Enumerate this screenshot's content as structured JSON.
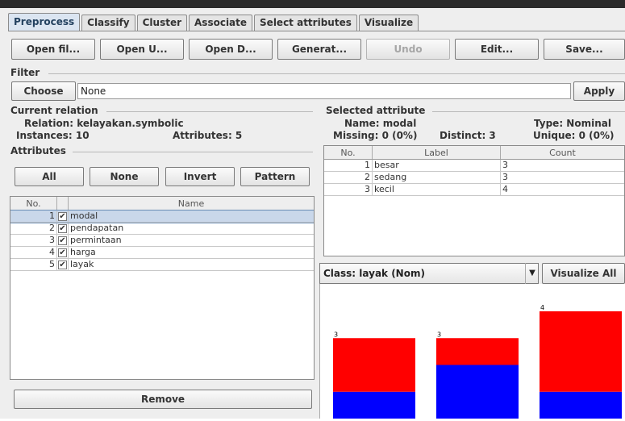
{
  "tabs": [
    "Preprocess",
    "Classify",
    "Cluster",
    "Associate",
    "Select attributes",
    "Visualize"
  ],
  "toolbar": {
    "open_file": "Open fil...",
    "open_url": "Open U...",
    "open_db": "Open D...",
    "generate": "Generat...",
    "undo": "Undo",
    "edit": "Edit...",
    "save": "Save..."
  },
  "filter": {
    "title": "Filter",
    "choose": "Choose",
    "value": "None",
    "apply": "Apply"
  },
  "current_relation": {
    "title": "Current relation",
    "relation": "Relation: kelayakan.symbolic",
    "instances": "Instances: 10",
    "attributes": "Attributes: 5"
  },
  "attributes": {
    "title": "Attributes",
    "all": "All",
    "none": "None",
    "invert": "Invert",
    "pattern": "Pattern",
    "col_no": "No.",
    "col_name": "Name",
    "rows": [
      {
        "no": "1",
        "name": "modal",
        "checked": true,
        "selected": true
      },
      {
        "no": "2",
        "name": "pendapatan",
        "checked": true,
        "selected": false
      },
      {
        "no": "3",
        "name": "permintaan",
        "checked": true,
        "selected": false
      },
      {
        "no": "4",
        "name": "harga",
        "checked": true,
        "selected": false
      },
      {
        "no": "5",
        "name": "layak",
        "checked": true,
        "selected": false
      }
    ],
    "remove": "Remove"
  },
  "selected_attribute": {
    "title": "Selected attribute",
    "name": "Name: modal",
    "type": "Type: Nominal",
    "missing": "Missing: 0 (0%)",
    "distinct": "Distinct: 3",
    "unique": "Unique: 0 (0%)",
    "col_no": "No.",
    "col_label": "Label",
    "col_count": "Count",
    "rows": [
      {
        "no": "1",
        "label": "besar",
        "count": "3"
      },
      {
        "no": "2",
        "label": "sedang",
        "count": "3"
      },
      {
        "no": "3",
        "label": "kecil",
        "count": "4"
      }
    ]
  },
  "class_select": {
    "value": "Class: layak (Nom)",
    "visualize_all": "Visualize All"
  },
  "chart_data": {
    "type": "bar",
    "categories": [
      "besar",
      "sedang",
      "kecil"
    ],
    "values": [
      3,
      3,
      4
    ],
    "ylim": [
      0,
      4
    ],
    "series": [
      {
        "color": "#0000ff",
        "values": [
          1,
          2,
          1
        ]
      },
      {
        "color": "#ff0000",
        "values": [
          2,
          1,
          3
        ]
      }
    ]
  }
}
